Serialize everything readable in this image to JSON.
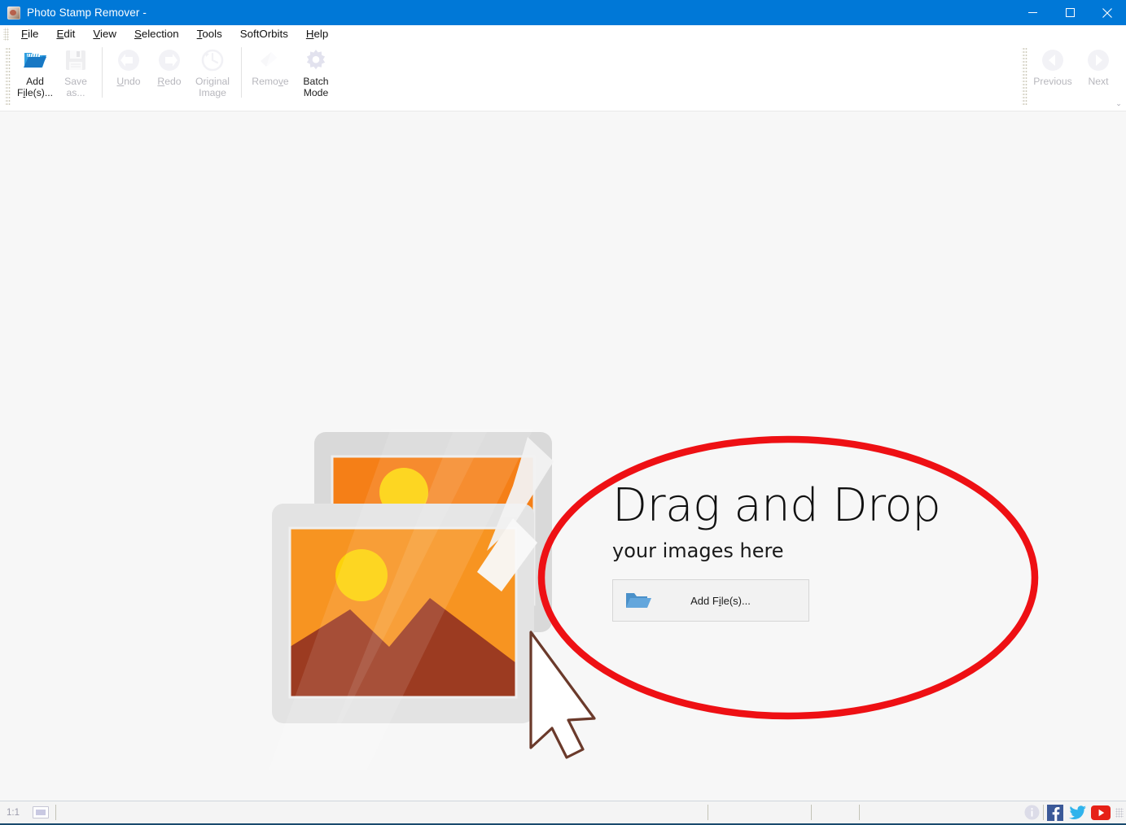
{
  "window": {
    "title": "Photo Stamp Remover -",
    "app_icon": "app-icon",
    "controls": {
      "minimize": "minimize-icon",
      "maximize": "maximize-icon",
      "close": "close-icon"
    },
    "accent_color": "#0078d7"
  },
  "menubar": [
    {
      "label": "File",
      "mnemonic": "F"
    },
    {
      "label": "Edit",
      "mnemonic": "E"
    },
    {
      "label": "View",
      "mnemonic": "V"
    },
    {
      "label": "Selection",
      "mnemonic": "S"
    },
    {
      "label": "Tools",
      "mnemonic": "T"
    },
    {
      "label": "SoftOrbits",
      "mnemonic": ""
    },
    {
      "label": "Help",
      "mnemonic": "H"
    }
  ],
  "toolbar": {
    "left": [
      {
        "label_line1": "Add",
        "label_line2": "File(s)...",
        "icon": "open-folder-icon",
        "enabled": true
      },
      {
        "label_line1": "Save",
        "label_line2": "as...",
        "icon": "floppy-save-icon",
        "enabled": false
      },
      {
        "label_line1": "Undo",
        "label_line2": "",
        "icon": "undo-arrow-icon",
        "enabled": false
      },
      {
        "label_line1": "Redo",
        "label_line2": "",
        "icon": "redo-arrow-icon",
        "enabled": false
      },
      {
        "label_line1": "Original",
        "label_line2": "Image",
        "icon": "clock-revert-icon",
        "enabled": false
      },
      {
        "label_line1": "Remove",
        "label_line2": "",
        "icon": "eraser-icon",
        "enabled": false
      },
      {
        "label_line1": "Batch",
        "label_line2": "Mode",
        "icon": "gear-icon",
        "enabled": true
      }
    ],
    "right": [
      {
        "label_line1": "Previous",
        "label_line2": "",
        "icon": "arrow-left-circle-icon",
        "enabled": false
      },
      {
        "label_line1": "Next",
        "label_line2": "",
        "icon": "arrow-right-circle-icon",
        "enabled": false
      }
    ],
    "expand_label": "⌄"
  },
  "dropzone": {
    "title": "Drag and Drop",
    "subtitle": "your images here",
    "button_label": "Add File(s)...",
    "button_mnemonic": "i",
    "button_icon": "blue-folder-icon",
    "illustration": "two-photo-frames-with-cursor",
    "annotation": {
      "shape": "ellipse",
      "color": "#ee1014",
      "stroke_width": 8
    }
  },
  "statusbar": {
    "zoom_level": "1:1",
    "thumbnail_icon": "image-thumbnail-icon",
    "info_icon": "info-icon",
    "facebook_icon": "facebook-icon",
    "twitter_icon": "twitter-icon",
    "youtube_icon": "youtube-icon",
    "resize_grip": "resize-grip-icon"
  }
}
